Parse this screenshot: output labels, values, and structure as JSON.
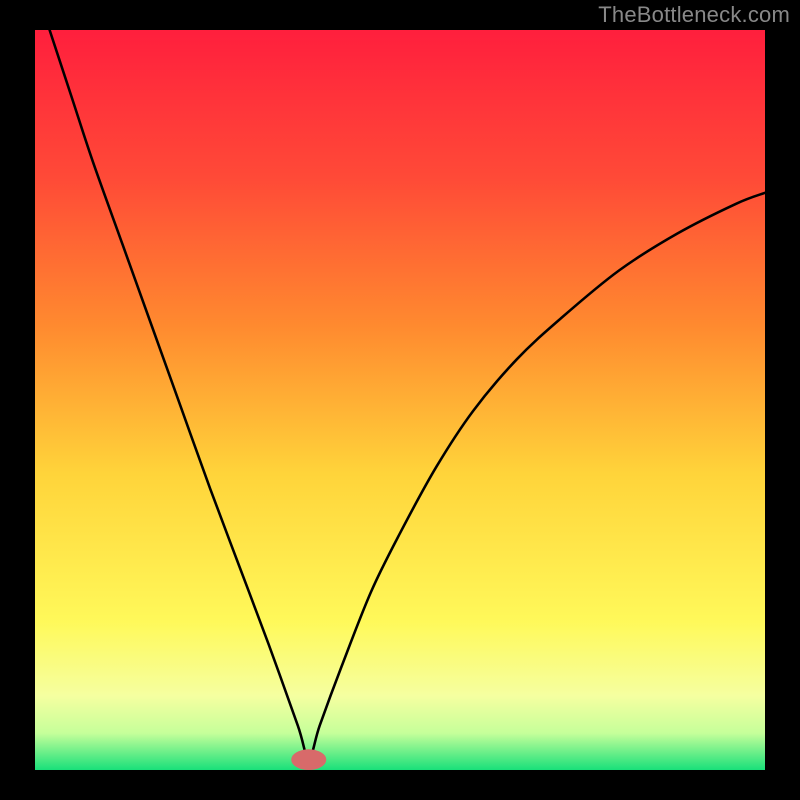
{
  "watermark": "TheBottleneck.com",
  "chart_data": {
    "type": "line",
    "title": "",
    "xlabel": "",
    "ylabel": "",
    "xlim": [
      0,
      100
    ],
    "ylim": [
      0,
      100
    ],
    "curve": {
      "name": "bottleneck-curve",
      "x": [
        2,
        5,
        8,
        12,
        16,
        20,
        24,
        28,
        32,
        36,
        37.5,
        39,
        42,
        46,
        50,
        55,
        60,
        66,
        72,
        80,
        88,
        96,
        100
      ],
      "y": [
        100,
        91,
        82,
        71,
        60,
        49,
        38,
        27.5,
        17,
        6,
        1.5,
        6,
        14,
        24,
        32,
        41,
        48.5,
        55.5,
        61,
        67.5,
        72.5,
        76.5,
        78
      ]
    },
    "gradient_stops": [
      {
        "offset": 0.0,
        "color": "#ff1f3d"
      },
      {
        "offset": 0.2,
        "color": "#ff4a37"
      },
      {
        "offset": 0.4,
        "color": "#ff8a2f"
      },
      {
        "offset": 0.6,
        "color": "#ffd43a"
      },
      {
        "offset": 0.8,
        "color": "#fff95a"
      },
      {
        "offset": 0.9,
        "color": "#f5ffa0"
      },
      {
        "offset": 0.95,
        "color": "#c6ff9a"
      },
      {
        "offset": 1.0,
        "color": "#19e07a"
      }
    ],
    "marker": {
      "x": 37.5,
      "y": 1.4,
      "rx": 2.4,
      "ry": 1.4,
      "color": "#d86a6a"
    }
  }
}
